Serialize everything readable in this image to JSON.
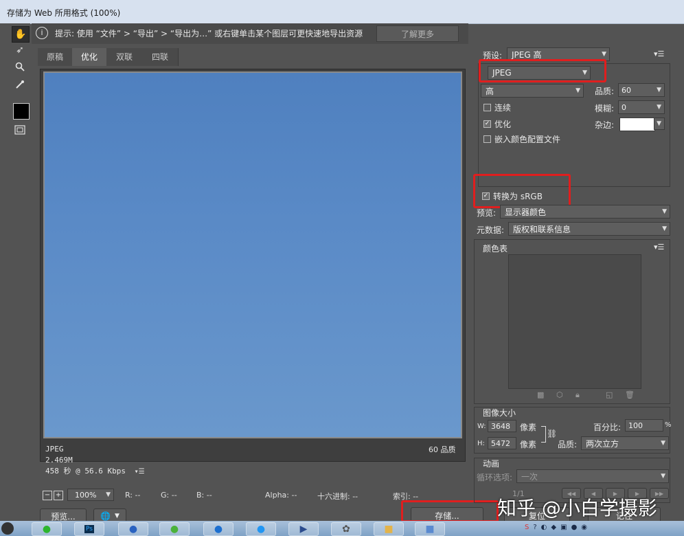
{
  "window": {
    "title": "存储为 Web 所用格式 (100%)"
  },
  "hint": {
    "text": "提示: 使用 “文件” > “导出” > “导出为…” 或右键单击某个图层可更快速地导出资源",
    "learn_more": "了解更多"
  },
  "tabs": [
    {
      "label": "原稿"
    },
    {
      "label": "优化"
    },
    {
      "label": "双联"
    },
    {
      "label": "四联"
    }
  ],
  "image_info": {
    "format": "JPEG",
    "size": "2.469M",
    "time": "458 秒 @ 56.6 Kbps",
    "quality_label": "60 品质"
  },
  "bottom": {
    "zoom": "100%",
    "r_label": "R: --",
    "g_label": "G: --",
    "b_label": "B: --",
    "alpha_label": "Alpha: --",
    "hex_label": "十六进制: --",
    "index_label": "索引: --",
    "preview_btn": "预览...",
    "save_btn": "存储...",
    "reset_btn": "复位",
    "remember_btn": "记住"
  },
  "settings": {
    "preset_label": "预设:",
    "preset_value": "JPEG 高",
    "format": "JPEG",
    "quality_level": "高",
    "quality_label": "品质:",
    "quality_value": "60",
    "progressive_label": "连续",
    "blur_label": "模糊:",
    "blur_value": "0",
    "optimized_label": "优化",
    "matte_label": "杂边:",
    "embed_profile_label": "嵌入颜色配置文件",
    "convert_srgb_label": "转换为 sRGB",
    "preview_label": "预览:",
    "preview_value": "显示器颜色",
    "metadata_label": "元数据:",
    "metadata_value": "版权和联系信息"
  },
  "color_table": {
    "title": "颜色表"
  },
  "image_size": {
    "title": "图像大小",
    "w_label": "W:",
    "w_value": "3648",
    "w_unit": "像素",
    "h_label": "H:",
    "h_value": "5472",
    "h_unit": "像素",
    "percent_label": "百分比:",
    "percent_value": "100",
    "percent_unit": "%",
    "quality_label": "品质:",
    "quality_value": "两次立方"
  },
  "animation": {
    "title": "动画",
    "loop_label": "循环选项:",
    "loop_value": "一次",
    "frame_counter": "1/1"
  },
  "watermark": "知乎 @小白学摄影",
  "colors": {
    "panel": "#535353",
    "sky_top": "#4f80bf",
    "sky_bottom": "#6a98cc",
    "highlight": "#e01e1e"
  }
}
